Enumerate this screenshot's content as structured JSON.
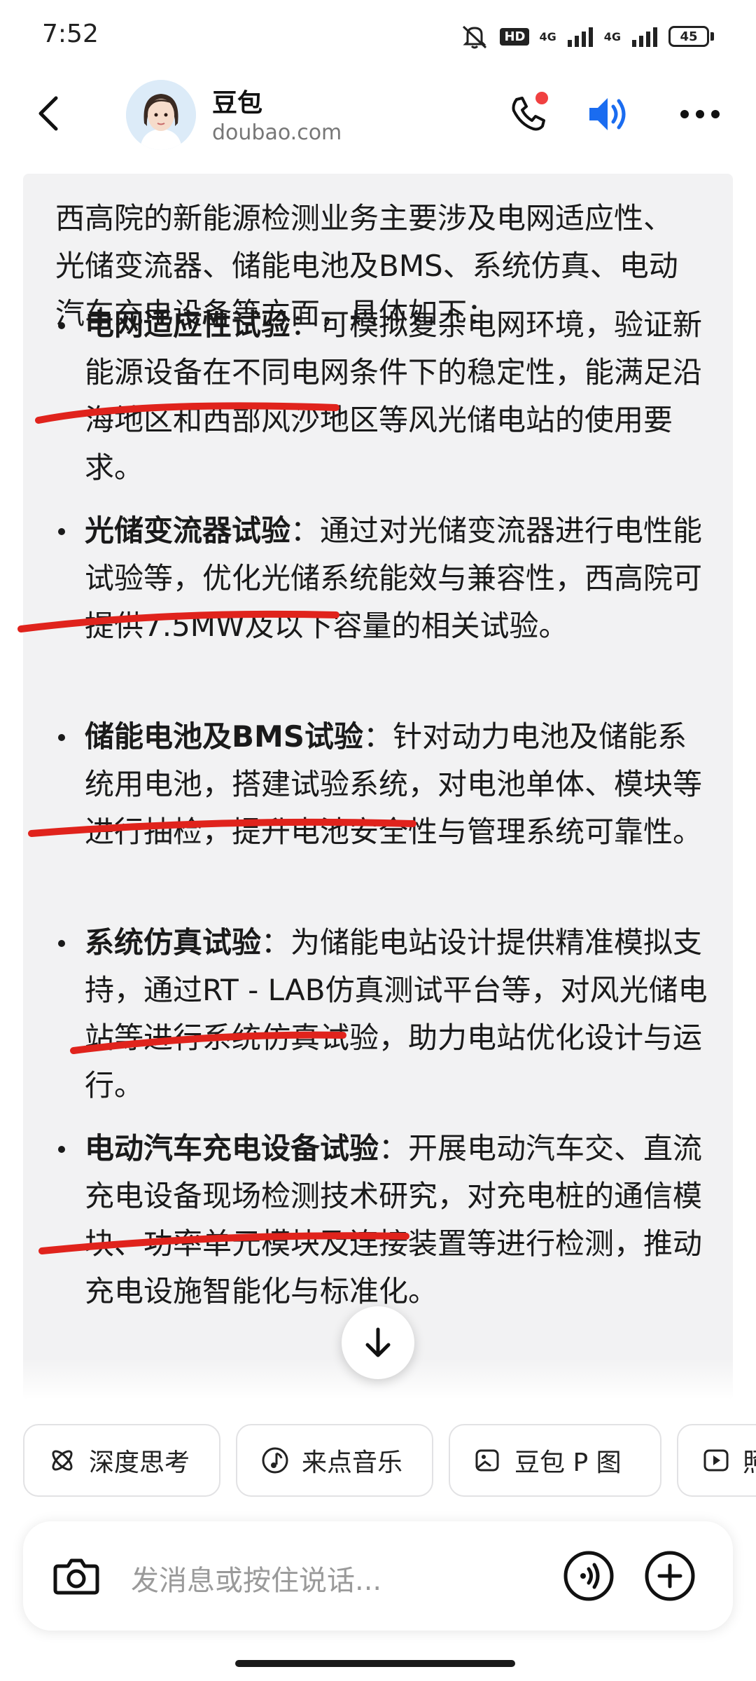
{
  "status_bar": {
    "time": "7:52",
    "hd": "HD",
    "net_1": "4G",
    "net_2": "4G",
    "battery": "45"
  },
  "header": {
    "title": "豆包",
    "domain": "doubao.com"
  },
  "message": {
    "intro": "西高院的新能源检测业务主要涉及电网适应性、光储变流器、储能电池及BMS、系统仿真、电动汽车充电设备等方面，具体如下：",
    "items": [
      {
        "title": "电网适应性试验",
        "text": "：可模拟复杂电网环境，验证新能源设备在不同电网条件下的稳定性，能满足沿海地区和西部风沙地区等风光储电站的使用要求。"
      },
      {
        "title": "光储变流器试验",
        "text": "：通过对光储变流器进行电性能试验等，优化光储系统能效与兼容性，西高院可提供7.5MW及以下容量的相关试验。"
      },
      {
        "title": "储能电池及BMS试验",
        "text": "：针对动力电池及储能系统用电池，搭建试验系统，对电池单体、模块等进行抽检，提升电池安全性与管理系统可靠性。"
      },
      {
        "title": "系统仿真试验",
        "text": "：为储能电站设计提供精准模拟支持，通过RT - LAB仿真测试平台等，对风光储电站等进行系统仿真试验，助力电站优化设计与运行。"
      },
      {
        "title": "电动汽车充电设备试验",
        "text": "：开展电动汽车交、直流充电设备现场检测技术研究，对充电桩的通信模块、功率单元模块及连接装置等进行检测，推动充电设施智能化与标准化。"
      }
    ]
  },
  "chips": [
    {
      "label": "深度思考",
      "icon": "atom-icon"
    },
    {
      "label": "来点音乐",
      "icon": "music-note-icon"
    },
    {
      "label": "豆包 P 图",
      "icon": "image-edit-icon"
    },
    {
      "label": "照",
      "icon": "video-play-icon"
    }
  ],
  "input": {
    "placeholder": "发消息或按住说话..."
  },
  "colors": {
    "accent": "#1a6cf0",
    "annotation": "#e0231c",
    "notification": "#f04040"
  }
}
